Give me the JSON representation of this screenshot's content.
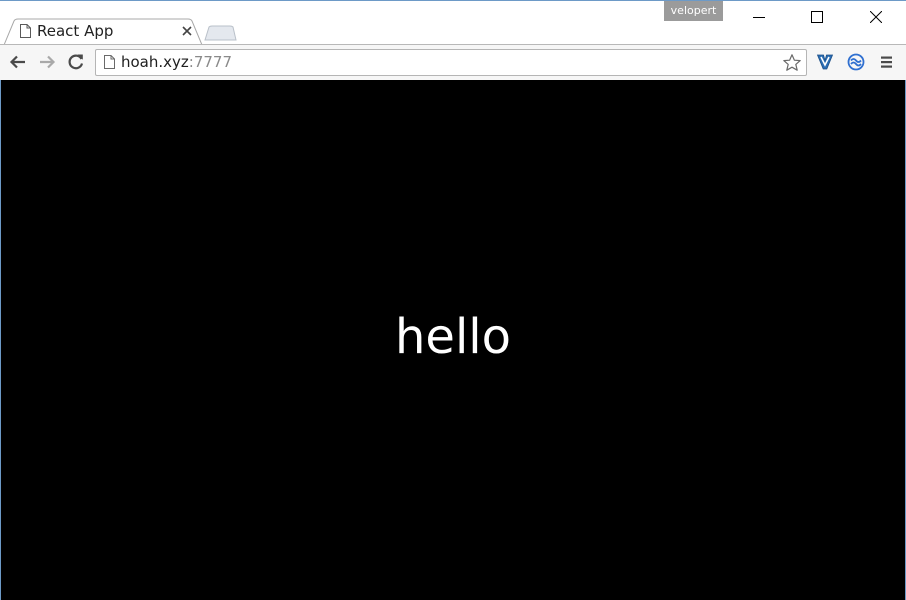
{
  "window": {
    "profile_name": "velopert",
    "colors": {
      "frame": "#6d9ac7",
      "toolbar": "#f6f6f6",
      "content_background": "#000000",
      "content_text": "#ffffff"
    }
  },
  "tabs": [
    {
      "title": "React App",
      "icon": "page-icon",
      "active": true
    }
  ],
  "toolbar": {
    "back_icon": "back-arrow-icon",
    "forward_icon": "forward-arrow-icon",
    "reload_icon": "reload-icon",
    "url_host": "hoah.xyz",
    "url_port": ":7777",
    "bookmark_icon": "star-icon",
    "extensions": [
      "vimium-extension-icon",
      "sync-extension-icon"
    ],
    "menu_icon": "hamburger-menu-icon"
  },
  "page": {
    "text": "hello"
  }
}
